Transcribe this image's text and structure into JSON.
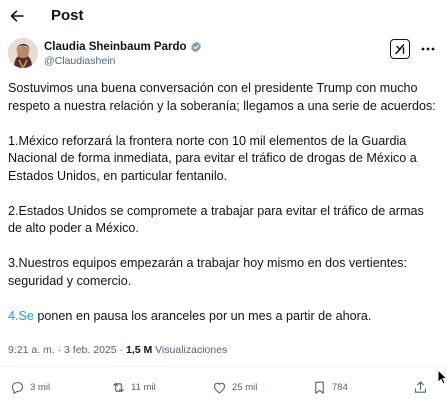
{
  "header": {
    "title": "Post",
    "back_icon": "arrow-left-icon"
  },
  "author": {
    "name": "Claudia Sheinbaum Pardo",
    "handle": "@Claudiashein",
    "verified_icon": "verified-badge-icon",
    "verified_color": "#829aab"
  },
  "tweet": {
    "paragraphs": [
      "Sostuvimos una buena conversación con el presidente Trump con mucho respeto a nuestra relación y la soberanía; llegamos a una serie de acuerdos:",
      "1.México reforzará la frontera norte con 10 mil elementos de la Guardia Nacional de forma inmediata, para evitar el tráfico de drogas de México a Estados Unidos, en particular fentanilo.",
      "2.Estados Unidos se compromete a trabajar para evitar el tráfico de armas de alto poder a México.",
      "3.Nuestros equipos empezarán a trabajar hoy mismo en dos vertientes: seguridad y comercio."
    ],
    "last_link": "4.Se",
    "last_rest": " ponen en pausa los aranceles por un mes a partir de ahora."
  },
  "meta": {
    "time": "9:21 a. m.",
    "separator": " · ",
    "date": "3 feb. 2025",
    "separator2": " · ",
    "views_count": "1,5 M",
    "views_label": " Visualizaciones"
  },
  "actions": {
    "replies": "3 mil",
    "reposts": "11 mil",
    "likes": "25 mil",
    "bookmarks": "784"
  },
  "colors": {
    "accent": "#1d9bf0",
    "secondary_text": "#536471",
    "primary_text": "#0f1419"
  }
}
